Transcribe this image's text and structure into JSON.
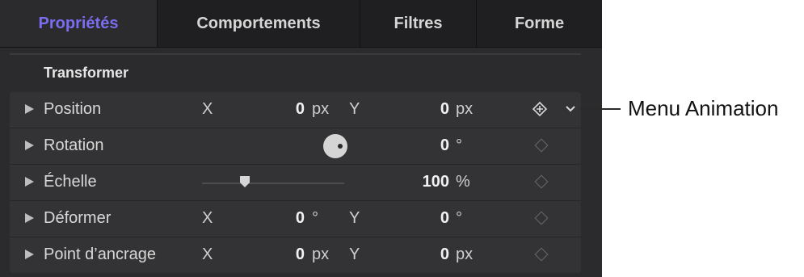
{
  "tabs": [
    {
      "label": "Propriétés",
      "active": true
    },
    {
      "label": "Comportements",
      "active": false
    },
    {
      "label": "Filtres",
      "active": false
    },
    {
      "label": "Forme",
      "active": false
    }
  ],
  "section": {
    "title": "Transformer"
  },
  "rows": [
    {
      "name": "Position",
      "x_label": "X",
      "x_value": "0",
      "x_unit": "px",
      "y_label": "Y",
      "y_value": "0",
      "y_unit": "px"
    },
    {
      "name": "Rotation",
      "value": "0",
      "unit": "°"
    },
    {
      "name": "Échelle",
      "value": "100",
      "unit": "%",
      "slider_fraction": 0.3
    },
    {
      "name": "Déformer",
      "x_label": "X",
      "x_value": "0",
      "x_unit": "°",
      "y_label": "Y",
      "y_value": "0",
      "y_unit": "°"
    },
    {
      "name": "Point d’ancrage",
      "x_label": "X",
      "x_value": "0",
      "x_unit": "px",
      "y_label": "Y",
      "y_value": "0",
      "y_unit": "px"
    }
  ],
  "callout": {
    "label": "Menu Animation"
  },
  "colors": {
    "accent": "#7b6cf0",
    "panel": "#2b2b2d",
    "tabbar": "#1f1f21",
    "row_bg": "#333335"
  },
  "icons": {
    "keyframe": "diamond-icon",
    "animation_menu": "chevron-down-icon",
    "disclosure": "disclosure-triangle-icon"
  }
}
